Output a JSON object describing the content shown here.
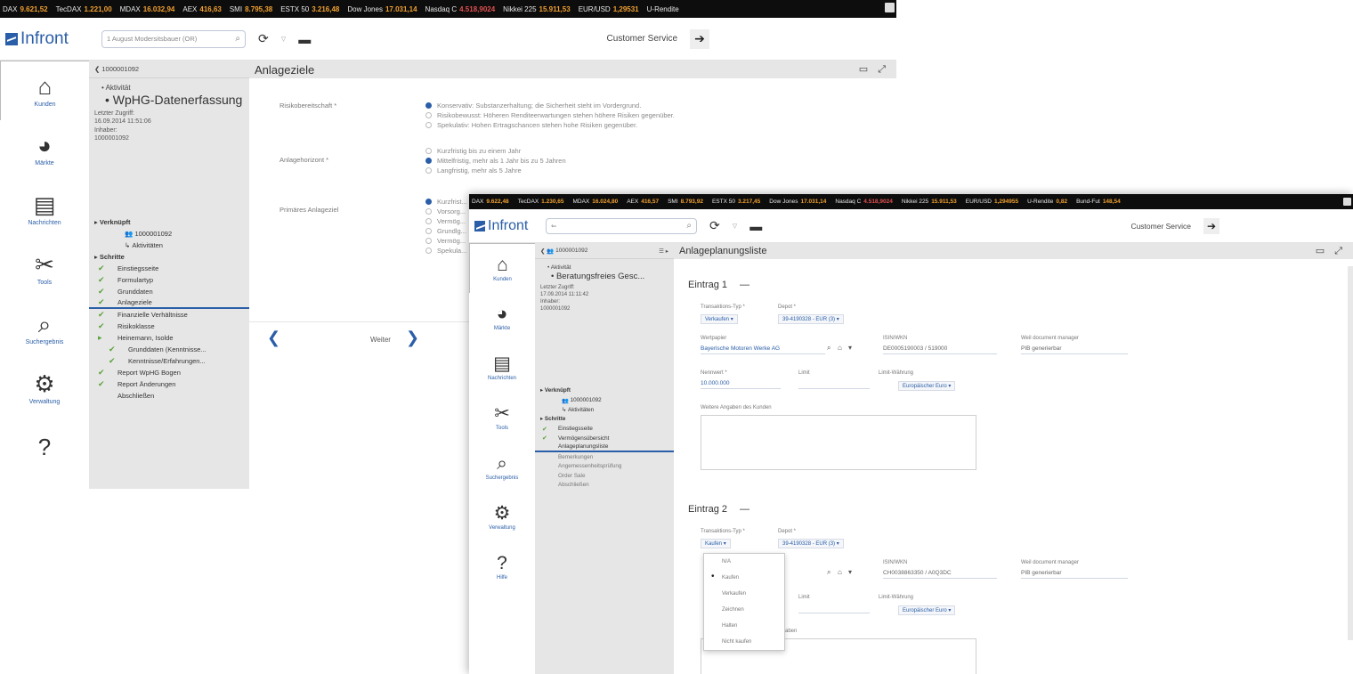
{
  "window1": {
    "ticker": [
      {
        "name": "DAX",
        "value": "9.621,52",
        "down": false
      },
      {
        "name": "TecDAX",
        "value": "1.221,00",
        "down": false
      },
      {
        "name": "MDAX",
        "value": "16.032,94",
        "down": false
      },
      {
        "name": "AEX",
        "value": "416,63",
        "down": false
      },
      {
        "name": "SMI",
        "value": "8.795,38",
        "down": false
      },
      {
        "name": "ESTX 50",
        "value": "3.216,48",
        "down": false
      },
      {
        "name": "Dow Jones",
        "value": "17.031,14",
        "down": false
      },
      {
        "name": "Nasdaq C",
        "value": "4.518,9024",
        "down": true
      },
      {
        "name": "Nikkei 225",
        "value": "15.911,53",
        "down": false
      },
      {
        "name": "EUR/USD",
        "value": "1,29531",
        "down": false
      },
      {
        "name": "U-Rendite",
        "value": "",
        "down": false
      }
    ],
    "logo": "Infront",
    "search": "1 August Modersitsbauer (OR)",
    "customer_service": "Customer Service",
    "nav": [
      "Kunden",
      "Märkte",
      "Nachrichten",
      "Tools",
      "Suchergebnis",
      "Verwaltung",
      ""
    ],
    "tree": {
      "id": "1000001092",
      "aktivitaet": "Aktivität",
      "title": "WpHG-Datenerfassung",
      "letzter_zugriff_label": "Letzter Zugriff:",
      "letzter_zugriff": "16.09.2014 11:51:06",
      "inhaber_label": "Inhaber:",
      "inhaber": "1000001092",
      "verknuepft": "Verknüpft",
      "link1": "1000001092",
      "link2": "Aktivitäten",
      "schritte": "Schritte",
      "steps": [
        "Einstiegsseite",
        "Formulartyp",
        "Grunddaten",
        "Anlageziele",
        "Finanzielle Verhältnisse",
        "Risikoklasse",
        "Heinemann, Isolde",
        "Grunddaten (Kenntnisse...",
        "Kenntnisse/Erfahrungen...",
        "Report WpHG Bogen",
        "Report Änderungen",
        "Abschließen"
      ]
    },
    "content": {
      "title": "Anlageziele",
      "risk_label": "Risikobereitschaft *",
      "risk_options": [
        "Konservativ: Substanzerhaltung; die Sicherheit steht im Vordergrund.",
        "Risikobewusst: Höheren Renditeerwartungen stehen höhere Risiken gegenüber.",
        "Spekulativ: Hohen Ertragschancen stehen hohe Risiken gegenüber."
      ],
      "horizon_label": "Anlagehorizont *",
      "horizon_options": [
        "Kurzfristig bis zu einem Jahr",
        "Mittelfristig, mehr als 1 Jahr bis zu 5 Jahren",
        "Langfristig, mehr als 5 Jahre"
      ],
      "primary_label": "Primäres Anlageziel",
      "primary_options": [
        "Kurzfrist...",
        "Vorsorg...",
        "Vermög...",
        "Grundlg...",
        "Vermög...",
        "Spekula..."
      ],
      "weiter": "Weiter"
    }
  },
  "window2": {
    "ticker": [
      {
        "name": "DAX",
        "value": "9.622,48",
        "down": false
      },
      {
        "name": "TecDAX",
        "value": "1.230,65",
        "down": false
      },
      {
        "name": "MDAX",
        "value": "16.024,80",
        "down": false
      },
      {
        "name": "AEX",
        "value": "416,57",
        "down": false
      },
      {
        "name": "SMI",
        "value": "8.793,92",
        "down": false
      },
      {
        "name": "ESTX 50",
        "value": "3.217,45",
        "down": false
      },
      {
        "name": "Dow Jones",
        "value": "17.031,14",
        "down": false
      },
      {
        "name": "Nasdaq C",
        "value": "4.518,9024",
        "down": true
      },
      {
        "name": "Nikkei 225",
        "value": "15.911,53",
        "down": false
      },
      {
        "name": "EUR/USD",
        "value": "1,294955",
        "down": false
      },
      {
        "name": "U-Rendite",
        "value": "0,82",
        "down": false
      },
      {
        "name": "Bund-Fut",
        "value": "148,54",
        "down": false
      }
    ],
    "logo": "Infront",
    "customer_service": "Customer Service",
    "nav": [
      "Kunden",
      "Märkte",
      "Nachrichten",
      "Tools",
      "Suchergebnis",
      "Verwaltung",
      "Hilfe"
    ],
    "tree": {
      "id": "1000001092",
      "aktivitaet": "Aktivität",
      "title": "Beratungsfreies Gesc...",
      "letzter_zugriff_label": "Letzter Zugriff:",
      "letzter_zugriff": "17.09.2014 11:11:42",
      "inhaber_label": "Inhaber:",
      "inhaber": "1000001092",
      "verknuepft": "Verknüpft",
      "link1": "1000001092",
      "link2": "Aktivitäten",
      "schritte": "Schritte",
      "steps": [
        "Einstiegsseite",
        "Vermögensübersicht",
        "Anlageplanungsliste",
        "Bemerkungen",
        "Angemessenheitsprüfung",
        "Order Sale",
        "Abschließen"
      ]
    },
    "content": {
      "title": "Anlageplanungsliste",
      "entry1": {
        "title": "Eintrag 1",
        "tx_type_label": "Transaktions-Typ *",
        "tx_type": "Verkaufen",
        "depot_label": "Depot *",
        "depot": "39-4190328 - EUR (3)",
        "wertpapier_label": "Wertpapier",
        "wertpapier": "Bayerische Motoren Werke AG",
        "isin_label": "ISIN/WKN",
        "isin": "DE0005190003 / 519000",
        "wdm_label": "Weil document manager",
        "wdm": "PIB generierbar",
        "nennwert_label": "Nennwert *",
        "nennwert": "10.000.000",
        "limit_label": "Limit",
        "limit_waehrung_label": "Limit-Währung",
        "limit_waehrung": "Europäischer Euro",
        "weitere_label": "Weitere Angaben des Kunden"
      },
      "entry2": {
        "title": "Eintrag 2",
        "tx_type_label": "Transaktions-Typ *",
        "tx_type": "Kaufen",
        "depot_label": "Depot *",
        "depot": "39-4190328 - EUR (3)",
        "isin_label": "ISIN/WKN",
        "isin": "CH0038863350 / A0Q3DC",
        "wdm_label": "Weil document manager",
        "wdm": "PIB generierbar",
        "limit_label": "Limit",
        "limit_waehrung_label": "Limit-Währung",
        "limit_waehrung": "Europäischer Euro",
        "weitere_label": "...aben"
      },
      "dropdown": [
        "N/A",
        "Kaufen",
        "Verkaufen",
        "Zeichnen",
        "Halten",
        "Nicht kaufen"
      ],
      "dropdown_selected": 1
    }
  }
}
